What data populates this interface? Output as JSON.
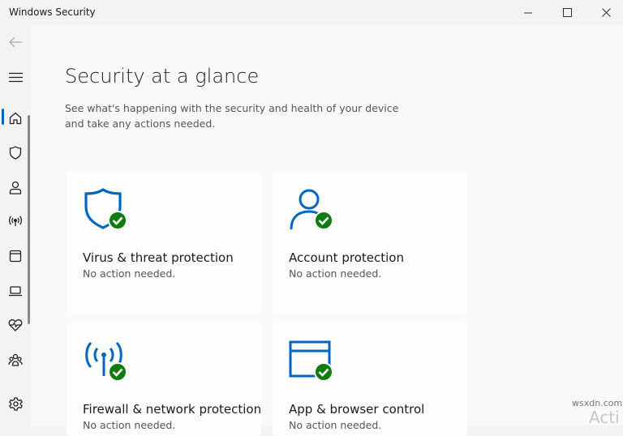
{
  "window": {
    "title": "Windows Security"
  },
  "sidebar": {
    "items": [
      {
        "name": "home",
        "icon": "home-icon"
      },
      {
        "name": "virus-threat",
        "icon": "shield-icon"
      },
      {
        "name": "account",
        "icon": "person-icon"
      },
      {
        "name": "firewall",
        "icon": "wifi-antenna-icon"
      },
      {
        "name": "app-browser",
        "icon": "app-window-icon"
      },
      {
        "name": "device-security",
        "icon": "laptop-icon"
      },
      {
        "name": "device-health",
        "icon": "heartbeat-icon"
      },
      {
        "name": "family",
        "icon": "family-icon"
      },
      {
        "name": "settings",
        "icon": "gear-icon"
      }
    ]
  },
  "main": {
    "title": "Security at a glance",
    "description": "See what's happening with the security and health of your device and take any actions needed.",
    "cards": [
      {
        "title": "Virus & threat protection",
        "status": "No action needed.",
        "icon": "shield-check-icon"
      },
      {
        "title": "Account protection",
        "status": "No action needed.",
        "icon": "person-check-icon"
      },
      {
        "title": "Firewall & network protection",
        "status": "No action needed.",
        "icon": "antenna-check-icon"
      },
      {
        "title": "App & browser control",
        "status": "No action needed.",
        "icon": "browser-window-check-icon"
      }
    ]
  },
  "watermarks": {
    "site": "wsxdn.com",
    "activate": "Acti"
  },
  "colors": {
    "accent": "#0067c0",
    "check": "#107c10"
  }
}
